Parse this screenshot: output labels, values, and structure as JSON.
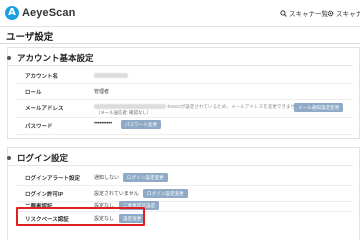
{
  "header": {
    "logo_mark": "A",
    "logo_text": "AeyeScan",
    "nav": {
      "scanner_list": "スキャナ一覧",
      "scanner_settings": "スキャナ"
    }
  },
  "page": {
    "title": "ユーザ設定"
  },
  "account_section": {
    "title": "アカウント基本設定",
    "rows": {
      "account_name": {
        "label": "アカウント名"
      },
      "role": {
        "label": "ロール",
        "value": "管理者"
      },
      "email": {
        "label": "メールアドレス",
        "note": "※SSOが設定されているため、メールアドレスを変更できません。",
        "sub": "（メール送信者: 確認なし）",
        "button": "メール通知設定変更"
      },
      "password": {
        "label": "パスワード",
        "value": "••••••••••",
        "button": "パスワード変更"
      }
    }
  },
  "login_section": {
    "title": "ログイン設定",
    "rows": {
      "login_alert": {
        "label": "ログインアラート設定",
        "value": "通知しない",
        "button": "ログイン設定変更"
      },
      "login_ip": {
        "label": "ログイン許可IP",
        "value": "設定されていません",
        "button": "ログイン設定変更"
      },
      "two_factor": {
        "label": "二要素認証",
        "value": "設定なし",
        "button": "二要素認証設定"
      },
      "risk_based": {
        "label": "リスクベース認証",
        "value": "設定なし",
        "button": "設定変更"
      }
    }
  },
  "colors": {
    "button_bg": "#8eaac6",
    "highlight_border": "#e02020",
    "logo": "#1a9fe0"
  }
}
